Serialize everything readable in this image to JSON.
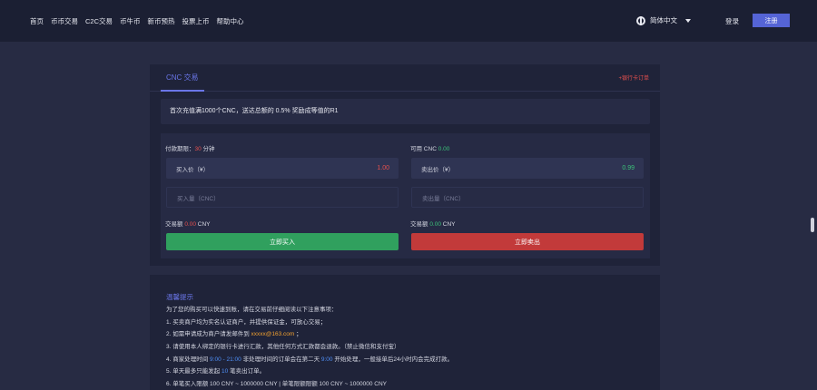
{
  "nav": [
    "首页",
    "币币交易",
    "C2C交易",
    "币牛币",
    "新币预热",
    "投票上币",
    "帮助中心"
  ],
  "header": {
    "language": "简体中文",
    "login": "登录",
    "register": "注册"
  },
  "tabs": {
    "active": "CNC 交易",
    "orders_link": "+银行卡订单"
  },
  "notice": "首次充值满1000个CNC，送达总额的 0.5% 奖励成等值的R1",
  "buy": {
    "limit_label": "付款期限：",
    "limit_value": "30",
    "limit_unit": "分钟",
    "price_label": "买入价（¥）",
    "price_value": "1.00",
    "qty_placeholder": "买入量（CNC）",
    "amount_label": "交易额",
    "amount_value": "0.00",
    "amount_unit": "CNY",
    "button": "立即买入"
  },
  "sell": {
    "avail_label": "可用 CNC",
    "avail_value": "0.00",
    "price_label": "卖出价（¥）",
    "price_value": "0.99",
    "qty_placeholder": "卖出量（CNC）",
    "amount_label": "交易额",
    "amount_value": "0.00",
    "amount_unit": "CNY",
    "button": "立即卖出"
  },
  "tips": {
    "title": "温馨提示",
    "intro": "为了您的购买可以快速到账，请在交易前仔细阅读以下注意事项：",
    "line1": "1. 买卖商户均为实名认证商户，并提供保证金，可放心交易；",
    "line2_a": "2. 如需申请成为商户请发邮件到",
    "line2_email": "xxxxx@163.com",
    "line2_b": "；",
    "line3": "3. 请使用本人绑定的银行卡进行汇款，其他任何方式汇款都会退款。（禁止微信和支付宝）",
    "line4_a": "4. 商家处理时间",
    "line4_time": "9:00 - 21:00",
    "line4_b": "非处理时间的订单会在第二天",
    "line4_time2": "9:00",
    "line4_c": "开始处理，一般接单后24小时内会完成打款。",
    "line5_a": "5. 单天最多只能发起",
    "line5_count": "10",
    "line5_b": "笔卖出订单。",
    "line6": "6. 单笔买入限额 100 CNY ~ 1000000 CNY  |  单笔限额限额 100 CNY ~ 1000000 CNY"
  }
}
